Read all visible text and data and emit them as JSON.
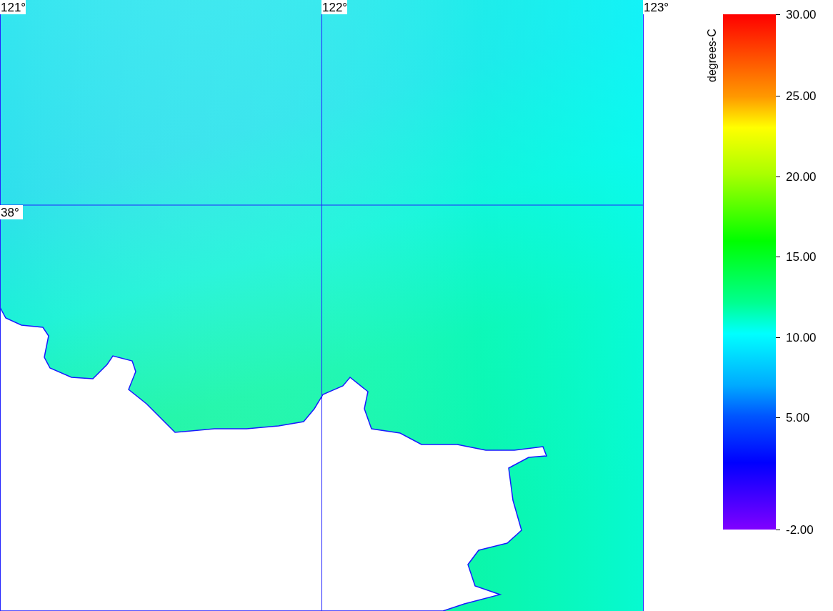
{
  "map": {
    "longitude_labels": [
      "121°",
      "122°",
      "123°"
    ],
    "latitude_labels": [
      "38°"
    ]
  },
  "legend": {
    "unit": "degrees-C",
    "ticks": [
      "30.00",
      "25.00",
      "20.00",
      "15.00",
      "10.00",
      "5.00",
      "-2.00"
    ]
  }
}
